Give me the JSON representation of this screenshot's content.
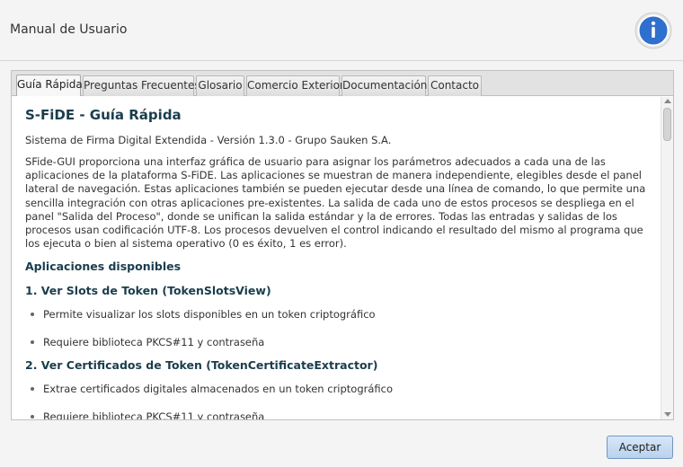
{
  "window": {
    "title": "Manual de Usuario"
  },
  "header": {
    "info_icon": "info-icon",
    "info_color": "#2f6fce"
  },
  "tabs": [
    {
      "label": "Guía Rápida",
      "active": true
    },
    {
      "label": "Preguntas Frecuentes",
      "active": false
    },
    {
      "label": "Glosario",
      "active": false
    },
    {
      "label": "Comercio Exterior",
      "active": false
    },
    {
      "label": "Documentación",
      "active": false
    },
    {
      "label": "Contacto",
      "active": false
    }
  ],
  "content": {
    "title": "S-FiDE - Guía Rápida",
    "subtitle": "Sistema de Firma Digital Extendida - Versión 1.3.0 - Grupo Sauken S.A.",
    "intro": "SFide-GUI proporciona una interfaz gráfica de usuario para asignar los parámetros adecuados a cada una de las aplicaciones de la plataforma S-FiDE. Las aplicaciones se muestran de manera independiente, elegibles desde el panel lateral de navegación. Estas aplicaciones también se pueden ejecutar desde una línea de comando, lo que permite una sencilla integración con otras aplicaciones pre-existentes. La salida de cada uno de estos procesos se despliega en el panel \"Salida del Proceso\", donde se unifican la salida estándar y la de errores. Todas las entradas y salidas de los procesos usan codificación UTF-8. Los procesos devuelven el control indicando el resultado del mismo al programa que los ejecuta o bien al sistema operativo (0 es éxito, 1 es error).",
    "section_title": "Aplicaciones disponibles",
    "apps": [
      {
        "title": "1. Ver Slots de Token (TokenSlotsView)",
        "items": [
          "Permite visualizar los slots disponibles en un token criptográfico",
          "Requiere biblioteca PKCS#11 y contraseña"
        ]
      },
      {
        "title": "2. Ver Certificados de Token (TokenCertificateExtractor)",
        "items": [
          "Extrae certificados digitales almacenados en un token criptográfico",
          "Requiere biblioteca PKCS#11 y contraseña"
        ]
      }
    ]
  },
  "footer": {
    "accept_label": "Aceptar"
  }
}
